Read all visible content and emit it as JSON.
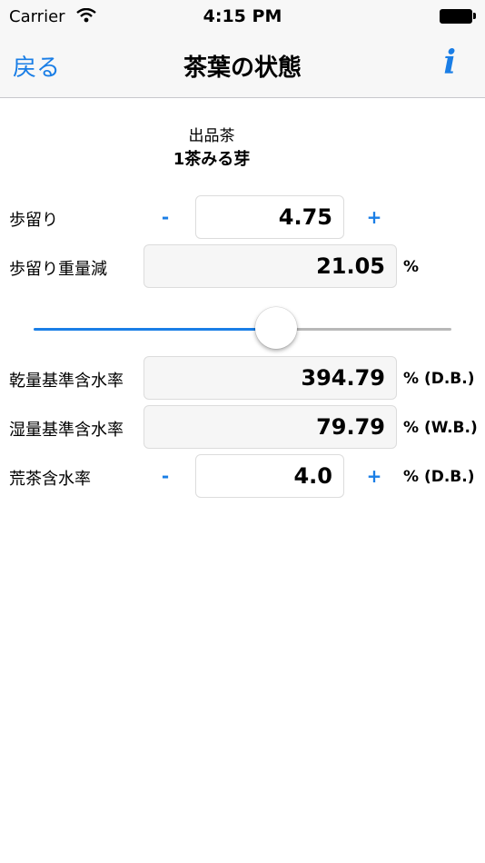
{
  "status_bar": {
    "carrier": "Carrier",
    "time": "4:15 PM"
  },
  "nav": {
    "back_label": "戻る",
    "title": "茶葉の状態",
    "info_label": "i"
  },
  "tea": {
    "category": "出品茶",
    "name": "1茶みる芽"
  },
  "rows": {
    "yield": {
      "label": "歩留り",
      "minus": "-",
      "value": "4.75",
      "plus": "+"
    },
    "yield_weight_loss": {
      "label": "歩留り重量減",
      "value": "21.05",
      "unit": "%"
    },
    "dry_basis": {
      "label": "乾量基準含水率",
      "value": "394.79",
      "unit": "% (D.B.)"
    },
    "wet_basis": {
      "label": "湿量基準含水率",
      "value": "79.79",
      "unit": "% (W.B.)"
    },
    "rough_tea": {
      "label": "荒茶含水率",
      "minus": "-",
      "value": "4.0",
      "plus": "+",
      "unit": "% (D.B.)"
    }
  },
  "slider": {
    "fraction": 0.58
  },
  "colors": {
    "accent": "#1a7ee6",
    "track_inactive": "#b8b8b8",
    "bar_background": "#f7f7f7"
  }
}
